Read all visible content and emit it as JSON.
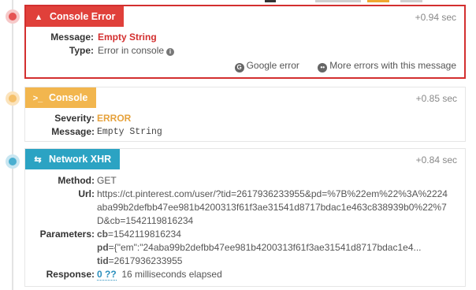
{
  "top_stubs": [
    {
      "color": "#333333"
    },
    {
      "color": "#cfcfcf"
    },
    {
      "color": "#f0a830"
    },
    {
      "color": "#cfcfcf"
    }
  ],
  "entries": [
    {
      "badge": {
        "label": "Console Error",
        "icon": "warning-icon",
        "color": "#e0403a"
      },
      "time": "+0.94 sec",
      "dot_color": "#e55353",
      "message_label": "Message:",
      "message_value": "Empty String",
      "type_label": "Type:",
      "type_value": "Error in console",
      "actions": [
        {
          "label": "Google error",
          "icon": "google-icon"
        },
        {
          "label": "More errors with this message",
          "icon": "more-icon"
        }
      ]
    },
    {
      "badge": {
        "label": "Console",
        "icon": "terminal-icon",
        "color": "#f2b64e"
      },
      "time": "+0.85 sec",
      "dot_color": "#f5c06a",
      "severity_label": "Severity:",
      "severity_value": "ERROR",
      "message_label": "Message:",
      "message_value": "Empty String"
    },
    {
      "badge": {
        "label": "Network XHR",
        "icon": "exchange-icon",
        "color": "#2ba3c3"
      },
      "time": "+0.84 sec",
      "dot_color": "#4aafd0",
      "method_label": "Method:",
      "method_value": "GET",
      "url_label": "Url:",
      "url_lines": [
        "https://ct.pinterest.com/user/?tid=2617936233955&pd=%7B%22em%22%3A%2224",
        "aba99b2defbb47ee981b4200313f61f3ae31541d8717bdac1e463c838939b0%22%7",
        "D&cb=1542119816234"
      ],
      "parameters_label": "Parameters:",
      "parameters": [
        {
          "key": "cb",
          "value": "=1542119816234"
        },
        {
          "key": "pd",
          "value": "={\"em\":\"24aba99b2defbb47ee981b4200313f61f3ae31541d8717bdac1e4..."
        },
        {
          "key": "tid",
          "value": "=2617936233955"
        }
      ],
      "response_label": "Response:",
      "response_link": "0 ??",
      "response_text": "16 milliseconds elapsed"
    }
  ]
}
